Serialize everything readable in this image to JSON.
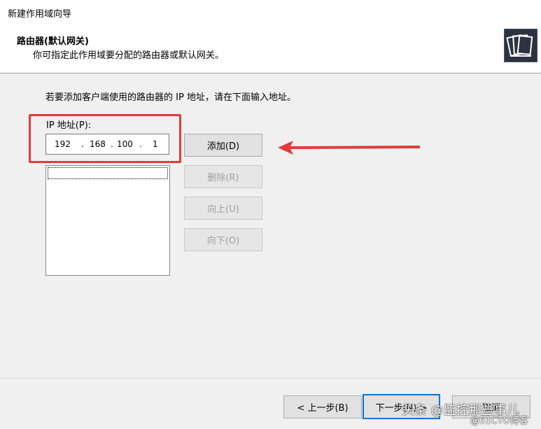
{
  "window": {
    "title": "新建作用域向导"
  },
  "header": {
    "title": "路由器(默认网关)",
    "subtitle": "你可指定此作用域要分配的路由器或默认网关。",
    "icon": "wizard-book-icon"
  },
  "main": {
    "intro": "若要添加客户端使用的路由器的 IP 地址，请在下面输入地址。",
    "ip_label": "IP 地址(P):",
    "ip_octets": [
      "192",
      "168",
      "100",
      "1"
    ],
    "ip_dot": ".",
    "router_list": [],
    "buttons": {
      "add": "添加(D)",
      "remove": "删除(R)",
      "up": "向上(U)",
      "down": "向下(O)"
    }
  },
  "footer": {
    "back": "< 上一步(B)",
    "next": "下一步(N) >",
    "cancel": "取消"
  },
  "annotations": {
    "highlight_color": "#e23b3b",
    "arrow_color": "#e23b3b"
  },
  "watermark": {
    "text": "头条 @监控那些事儿",
    "sub": "@51CTO博客"
  }
}
